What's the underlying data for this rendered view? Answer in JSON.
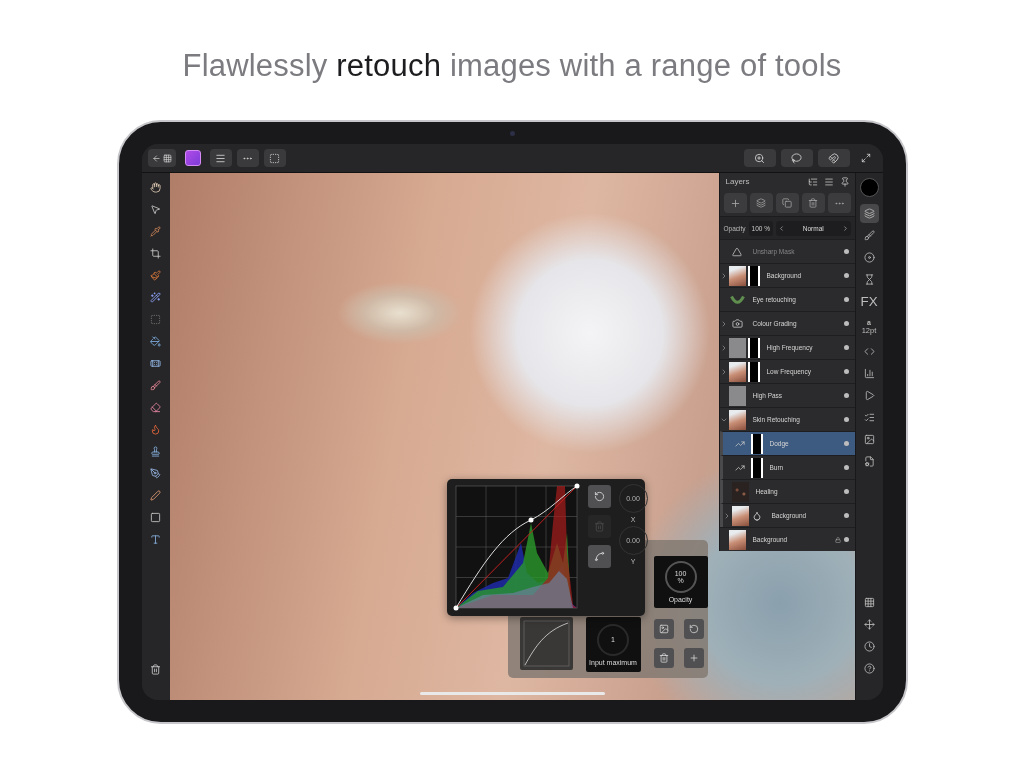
{
  "headline": "Flawlessly **retouch** images with a range of tools",
  "layers_panel": {
    "title": "Layers",
    "opacity_label": "Opacity",
    "opacity_value": "100 %",
    "blend_mode": "Normal",
    "layers": [
      {
        "name": "Unsharp Mask",
        "kind": "filter",
        "masked": false,
        "expandable": false,
        "dimmed": true,
        "locked": false,
        "selected": false
      },
      {
        "name": "Background",
        "kind": "image",
        "masked": true,
        "expandable": true,
        "expanded": false,
        "dimmed": false,
        "locked": false,
        "selected": false
      },
      {
        "name": "Eye retouching",
        "kind": "brush",
        "masked": false,
        "expandable": false,
        "dimmed": false,
        "locked": false,
        "selected": false
      },
      {
        "name": "Colour Grading",
        "kind": "adjustment",
        "masked": false,
        "expandable": true,
        "expanded": false,
        "dimmed": false,
        "locked": false,
        "selected": false
      },
      {
        "name": "High Frequency",
        "kind": "pixel",
        "masked": true,
        "expandable": true,
        "expanded": false,
        "dimmed": false,
        "locked": false,
        "selected": false
      },
      {
        "name": "Low Frequency",
        "kind": "image",
        "masked": true,
        "expandable": true,
        "expanded": false,
        "dimmed": false,
        "locked": false,
        "selected": false
      },
      {
        "name": "High Pass",
        "kind": "pixel",
        "masked": false,
        "expandable": false,
        "dimmed": false,
        "locked": false,
        "selected": false
      },
      {
        "name": "Skin Retouching",
        "kind": "image",
        "masked": false,
        "expandable": true,
        "expanded": true,
        "dimmed": false,
        "locked": false,
        "selected": false,
        "children": [
          {
            "name": "Dodge",
            "kind": "curves",
            "masked": true,
            "expandable": false,
            "dimmed": false,
            "locked": false,
            "selected": true
          },
          {
            "name": "Burn",
            "kind": "curves",
            "masked": true,
            "expandable": false,
            "dimmed": false,
            "locked": false,
            "selected": false
          },
          {
            "name": "Healing",
            "kind": "healing",
            "masked": false,
            "expandable": false,
            "dimmed": false,
            "locked": false,
            "selected": false
          },
          {
            "name": "Background",
            "kind": "fill",
            "masked": false,
            "expandable": true,
            "expanded": false,
            "dimmed": false,
            "locked": false,
            "selected": false
          }
        ]
      },
      {
        "name": "Background",
        "kind": "image",
        "masked": false,
        "expandable": false,
        "dimmed": false,
        "locked": true,
        "selected": false
      }
    ]
  },
  "studio_tabs": [
    {
      "kind": "icon",
      "selected": true
    },
    {
      "kind": "icon",
      "selected": false
    },
    {
      "kind": "icon",
      "selected": false
    },
    {
      "kind": "icon",
      "selected": false
    },
    {
      "kind": "text",
      "label": "FX",
      "selected": false
    },
    {
      "kind": "text_size",
      "label": "a",
      "sublabel": "12pt",
      "selected": false
    },
    {
      "kind": "icon",
      "selected": false
    },
    {
      "kind": "icon",
      "selected": false
    },
    {
      "kind": "icon",
      "selected": false
    },
    {
      "kind": "icon",
      "selected": false
    },
    {
      "kind": "icon",
      "selected": false
    },
    {
      "kind": "icon",
      "selected": false
    }
  ],
  "curves": {
    "x_value": "0.00",
    "x_label": "X",
    "y_value": "0.00",
    "y_label": "Y"
  },
  "adjust_panel": {
    "opacity_value": "100",
    "opacity_unit": "%",
    "opacity_label": "Opacity",
    "input_value": "1",
    "input_label": "Input maximum"
  }
}
